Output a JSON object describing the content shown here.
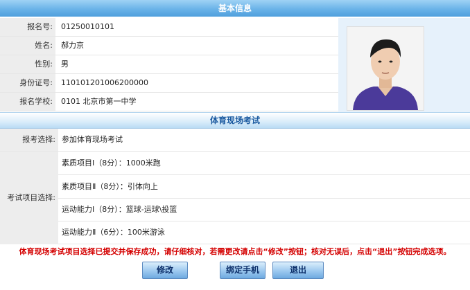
{
  "basic_info": {
    "title": "基本信息",
    "fields": [
      {
        "label": "报名号:",
        "value": "01250010101"
      },
      {
        "label": "姓名:",
        "value": "郝力京"
      },
      {
        "label": "性别:",
        "value": "男"
      },
      {
        "label": "身份证号:",
        "value": "110101201006200000"
      },
      {
        "label": "报名学校:",
        "value": "0101 北京市第一中学"
      }
    ]
  },
  "sports_exam": {
    "title": "体育现场考试",
    "choice_label": "报考选择:",
    "choice_value": "参加体育现场考试",
    "items_label": "考试项目选择:",
    "items": [
      "素质项目Ⅰ（8分）：1000米跑",
      "素质项目Ⅱ（8分）：引体向上",
      "运动能力Ⅰ（8分）：篮球-运球\\投篮",
      "运动能力Ⅱ（6分）：100米游泳"
    ]
  },
  "notice": "体育现场考试项目选择已提交并保存成功，请仔细核对，若需更改请点击“修改”按钮；核对无误后，点击“退出”按钮完成选项。",
  "buttons": {
    "modify": "修改",
    "bind_phone": "绑定手机",
    "exit": "退出"
  }
}
